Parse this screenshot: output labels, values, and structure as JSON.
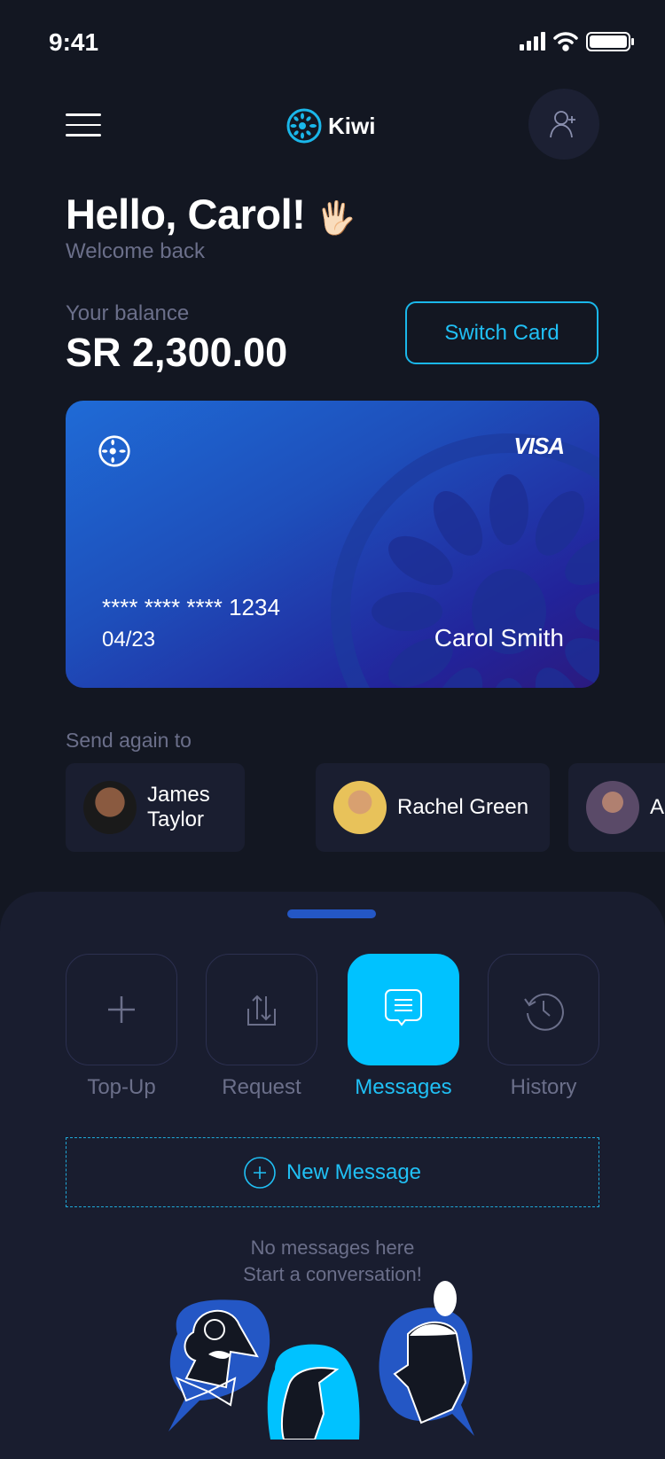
{
  "status_bar": {
    "time": "9:41"
  },
  "header": {
    "brand": "Kiwi"
  },
  "greeting": {
    "title": "Hello, Carol!",
    "emoji": "🖐🏻",
    "subtitle": "Welcome back"
  },
  "balance": {
    "label": "Your balance",
    "amount": "SR 2,300.00",
    "switch_label": "Switch Card"
  },
  "card": {
    "number": "**** **** **** 1234",
    "expiry": "04/23",
    "holder": "Carol Smith",
    "network": "VISA"
  },
  "send_again": {
    "label": "Send again to",
    "contacts": [
      {
        "name": "James Taylor",
        "color": "#3a2a22"
      },
      {
        "name": "Rachel Green",
        "color": "#e8c25a"
      },
      {
        "name": "Ad",
        "color": "#6a5a70"
      }
    ]
  },
  "actions": [
    {
      "label": "Top-Up",
      "icon": "plus-icon"
    },
    {
      "label": "Request",
      "icon": "transfer-icon"
    },
    {
      "label": "Messages",
      "icon": "message-icon",
      "active": true
    },
    {
      "label": "History",
      "icon": "history-icon"
    }
  ],
  "messages": {
    "new_label": "New Message",
    "empty_line1": "No messages here",
    "empty_line2": "Start a conversation!"
  },
  "colors": {
    "accent": "#00c2ff",
    "background": "#131722",
    "sheet": "#191d2f",
    "card": "#1e4fbb"
  }
}
